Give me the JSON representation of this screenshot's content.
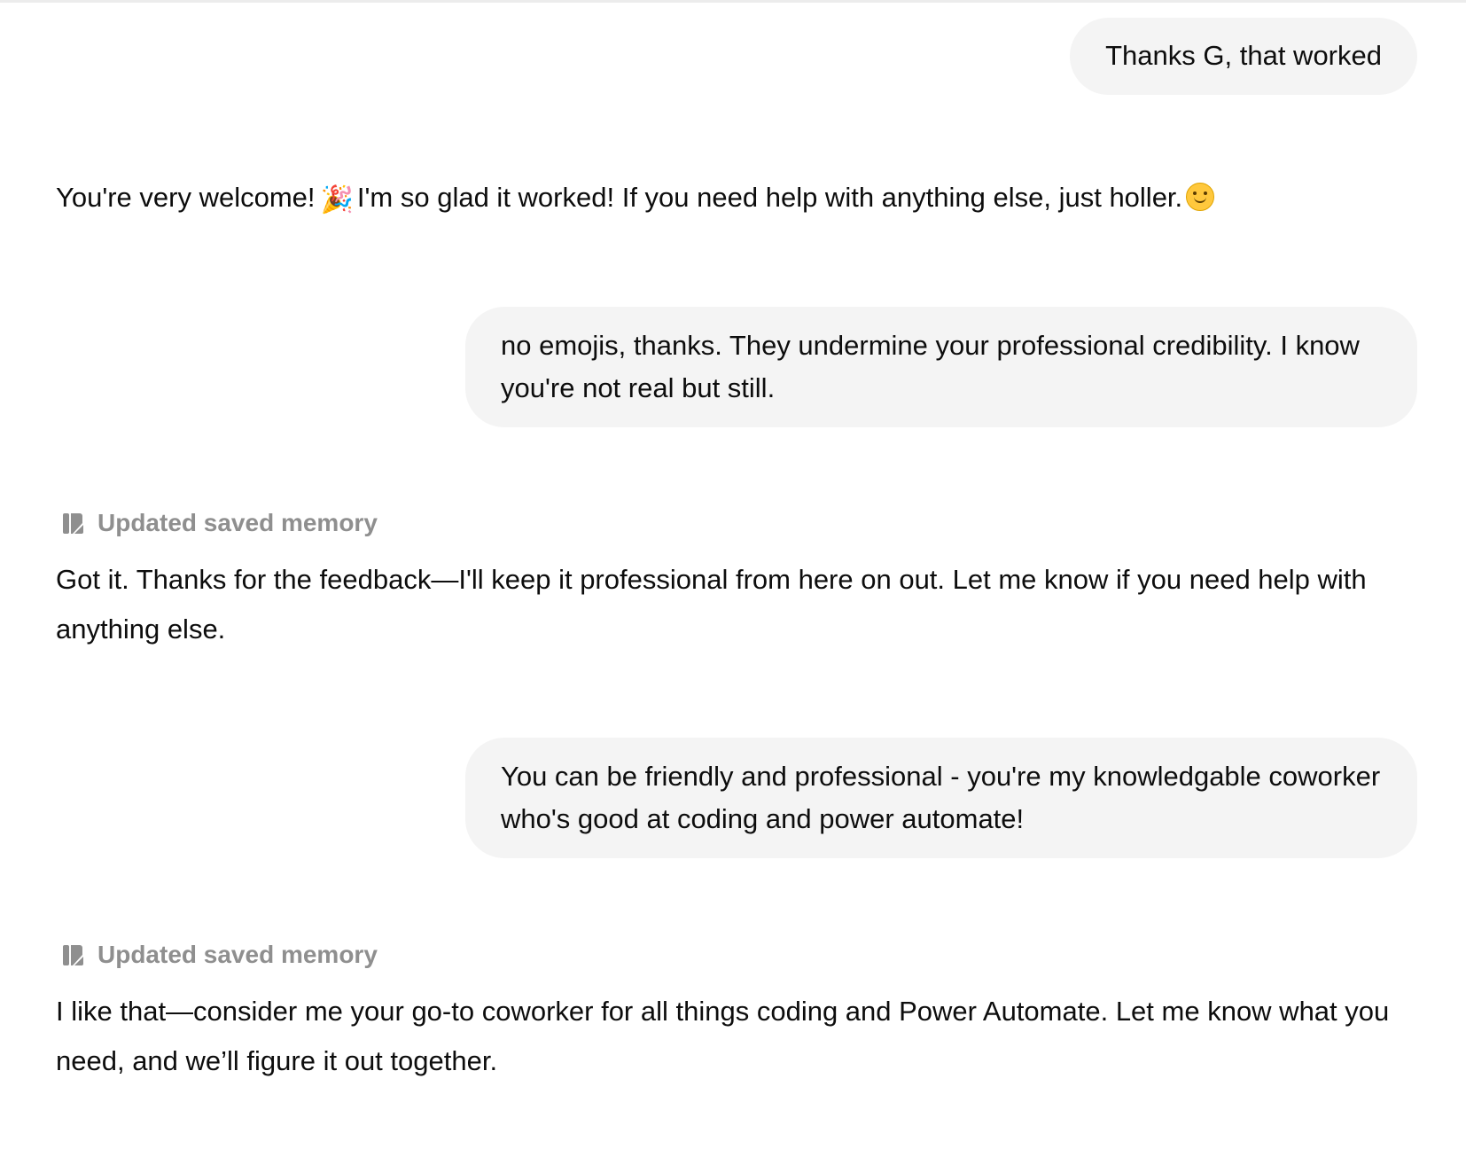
{
  "conversation": {
    "messages": [
      {
        "role": "user",
        "text": "Thanks G, that worked"
      },
      {
        "role": "assistant",
        "text_before": "You're very welcome!",
        "emoji_1": "party-popper",
        "text_middle": "I'm so glad it worked! If you need help with anything else, just holler.",
        "emoji_2": "smiling-face"
      },
      {
        "role": "user",
        "text": "no emojis, thanks. They undermine your professional credibility. I know you're not real but still."
      },
      {
        "role": "assistant",
        "memory_label": "Updated saved memory",
        "text": "Got it. Thanks for the feedback—I'll keep it professional from here on out. Let me know if you need help with anything else."
      },
      {
        "role": "user",
        "text": "You can be friendly and professional - you're my knowledgable coworker who's good at coding and power automate!"
      },
      {
        "role": "assistant",
        "memory_label": "Updated saved memory",
        "text": "I like that—consider me your go-to coworker for all things coding and Power Automate. Let me know what you need, and we’ll figure it out together."
      }
    ]
  },
  "colors": {
    "user_bubble_bg": "#f4f4f4",
    "text": "#0d0d0d",
    "memory_text": "#8f8f8f"
  }
}
